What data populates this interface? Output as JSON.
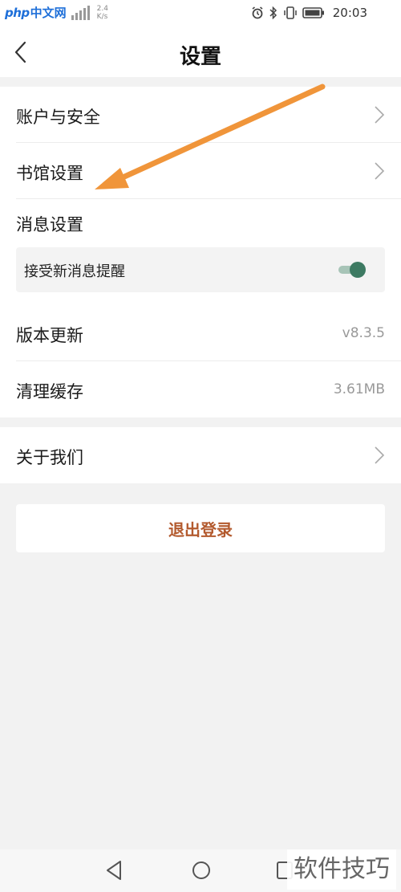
{
  "status_bar": {
    "watermark_logo": "php",
    "watermark_site": "中文网",
    "net_speed_value": "2.4",
    "net_speed_unit": "K/s",
    "time": "20:03"
  },
  "header": {
    "title": "设置"
  },
  "settings": {
    "account_security": "账户与安全",
    "library_settings": "书馆设置",
    "message_settings": "消息设置",
    "receive_notifications": "接受新消息提醒",
    "receive_notifications_on": true,
    "version_update": "版本更新",
    "version_value": "v8.3.5",
    "clear_cache": "清理缓存",
    "cache_size": "3.61MB",
    "about_us": "关于我们"
  },
  "logout_label": "退出登录",
  "watermark_bottom": "软件技巧",
  "colors": {
    "annotation_arrow": "#f0953a",
    "toggle_on": "#3d7a62",
    "logout_text": "#b35a2e"
  }
}
